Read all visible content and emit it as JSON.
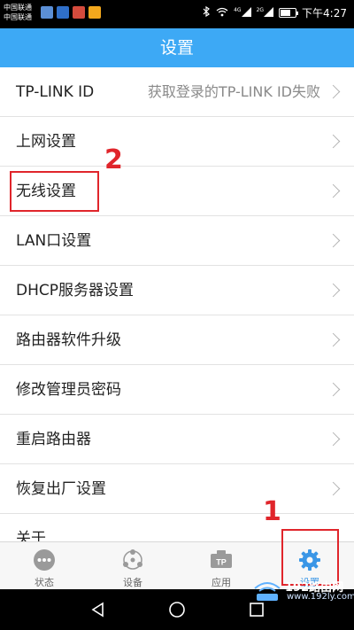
{
  "status_bar": {
    "carrier_1": "中国联通",
    "carrier_2": "中国联通",
    "signal_1_tag": "4G",
    "signal_2_tag": "2G",
    "time": "下午4:27",
    "battery_level": 0.7,
    "icons": [
      "bluetooth-icon",
      "wifi-icon",
      "signal-icon",
      "battery-icon"
    ]
  },
  "header": {
    "title": "设置"
  },
  "settings_list": {
    "items": [
      {
        "label": "TP-LINK ID",
        "value": "获取登录的TP-LINK ID失败"
      },
      {
        "label": "上网设置"
      },
      {
        "label": "无线设置"
      },
      {
        "label": "LAN口设置"
      },
      {
        "label": "DHCP服务器设置"
      },
      {
        "label": "路由器软件升级"
      },
      {
        "label": "修改管理员密码"
      },
      {
        "label": "重启路由器"
      },
      {
        "label": "恢复出厂设置"
      },
      {
        "label": "关于"
      }
    ]
  },
  "annotations": {
    "step_1": "1",
    "step_2": "2",
    "color": "#e0252b"
  },
  "tab_bar": {
    "tabs": [
      {
        "label": "状态",
        "icon": "status-icon"
      },
      {
        "label": "设备",
        "icon": "devices-icon"
      },
      {
        "label": "应用",
        "icon": "apps-icon",
        "badge": "TP"
      },
      {
        "label": "设置",
        "icon": "gear-icon",
        "active": true
      }
    ]
  },
  "watermark": {
    "text": "192路由网",
    "url": "www.192ly.com"
  },
  "colors": {
    "accent": "#3da9f5",
    "active_tab": "#3a96e6"
  }
}
